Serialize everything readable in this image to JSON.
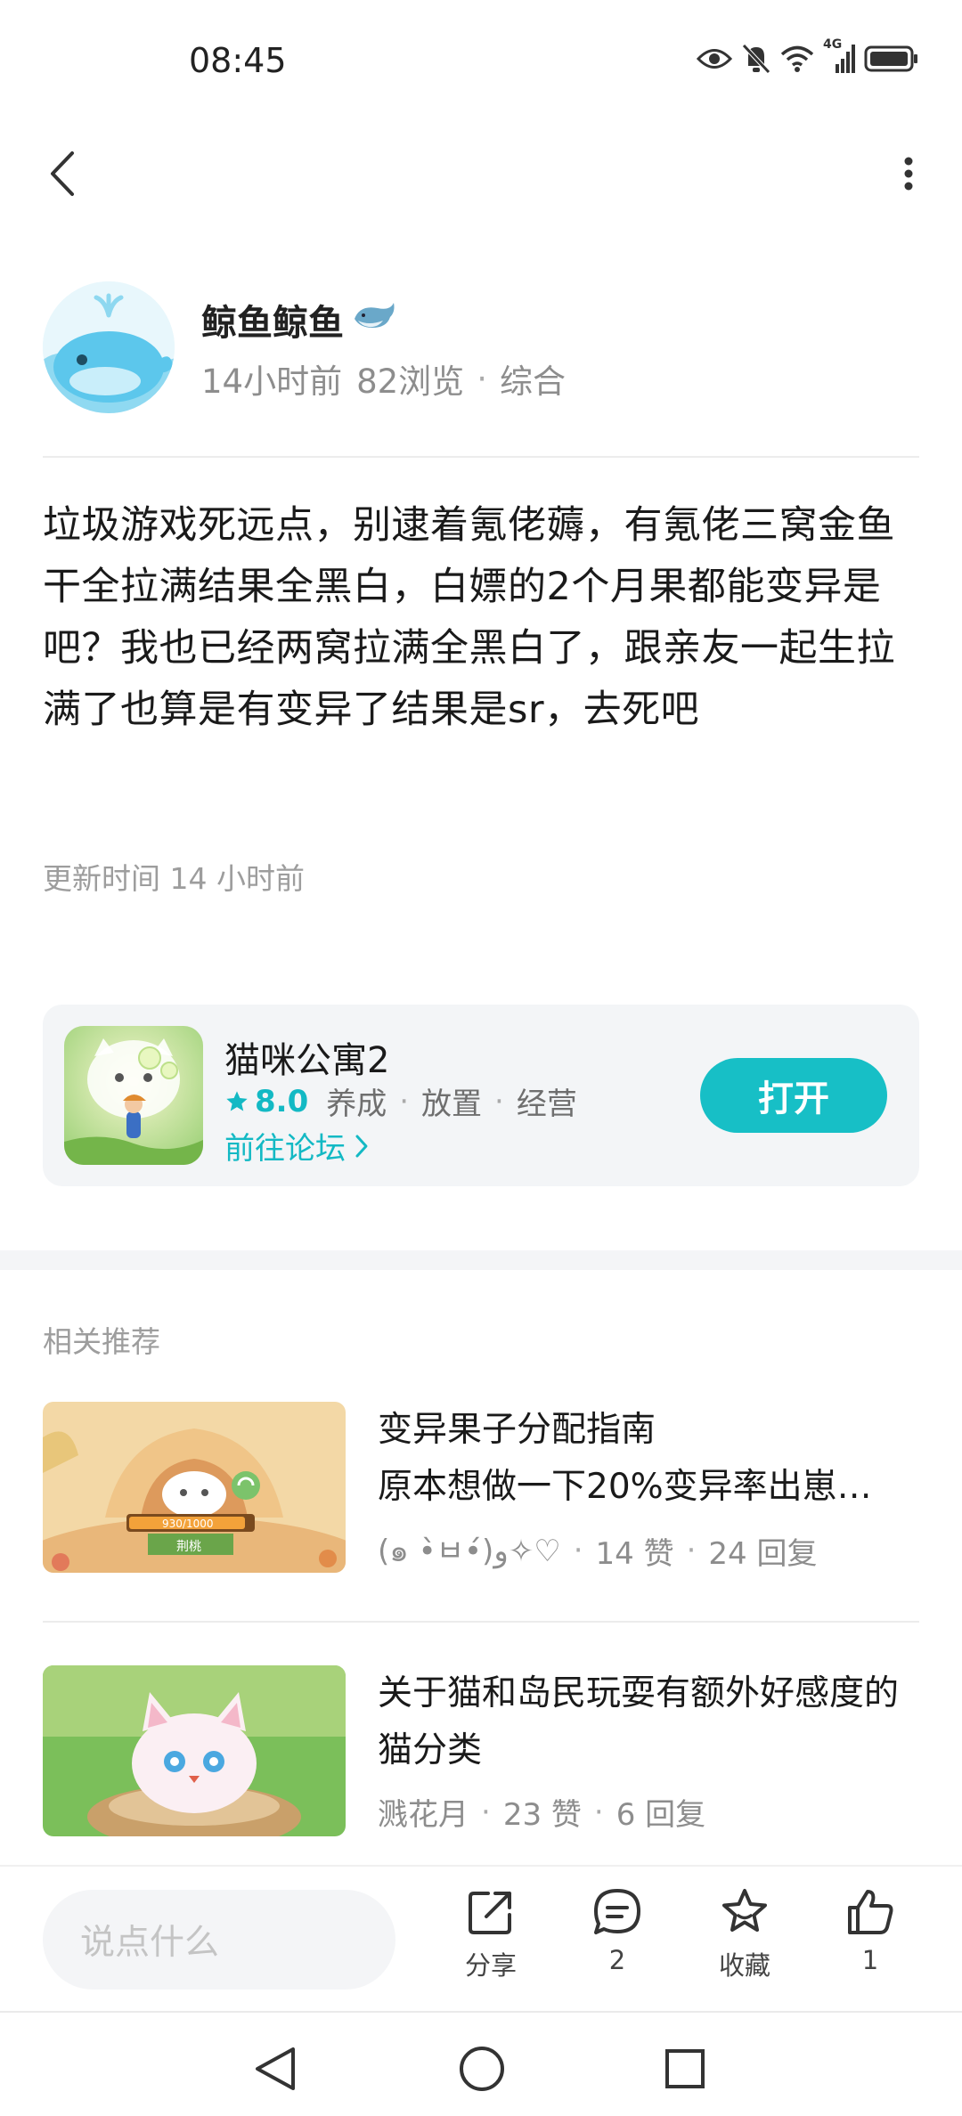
{
  "status_bar": {
    "time": "08:45",
    "network": "4G",
    "icons": [
      "eye-icon",
      "mute-bell-icon",
      "wifi-icon",
      "signal-icon",
      "battery-icon"
    ]
  },
  "nav": {
    "back_icon": "back-chevron-icon",
    "more_icon": "more-dots-icon"
  },
  "author": {
    "name": "鲸鱼鲸鱼",
    "badge_icon": "whale-emoji-icon",
    "time_ago": "14小时前",
    "views": "82浏览",
    "category": "综合"
  },
  "post": {
    "content": "垃圾游戏死远点，别逮着氪佬薅，有氪佬三窝金鱼干全拉满结果全黑白，白嫖的2个月果都能变异是吧？我也已经两窝拉满全黑白了，跟亲友一起生拉满了也算是有变异了结果是sr，去死吧",
    "update_time": "更新时间 14 小时前"
  },
  "game_card": {
    "name": "猫咪公寓2",
    "rating": "8.0",
    "tags": [
      "养成",
      "放置",
      "经营"
    ],
    "forum_link": "前往论坛",
    "open_label": "打开"
  },
  "related": {
    "title": "相关推荐",
    "items": [
      {
        "title_line1": "变异果子分配指南",
        "title_line2": "原本想做一下20%变异率出崽…",
        "author": "(๑ •̀ㅂ•́)و✧♡",
        "likes": "14 赞",
        "replies": "24 回复",
        "thumb_progress_text": "930/1000",
        "thumb_label": "荆桃"
      },
      {
        "title": "关于猫和岛民玩耍有额外好感度的猫分类",
        "author": "溅花月",
        "likes": "23 赞",
        "replies": "6 回复"
      }
    ]
  },
  "bottom_bar": {
    "comment_placeholder": "说点什么",
    "share_label": "分享",
    "comment_count": "2",
    "favorite_label": "收藏",
    "like_count": "1"
  },
  "colors": {
    "accent": "#17bfc6",
    "text_primary": "#1a1a1a",
    "text_secondary": "#8d8d8d"
  }
}
